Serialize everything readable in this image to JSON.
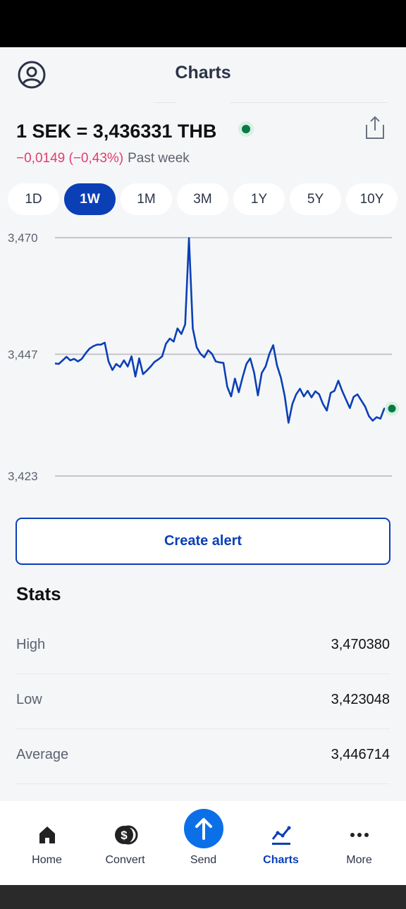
{
  "header": {
    "title": "Charts",
    "profile_icon": "profile-icon",
    "share_icon": "share-icon"
  },
  "rate": {
    "text": "1 SEK = 3,436331 THB",
    "change": "−0,0149 (−0,43%)",
    "period_text": "Past week",
    "live_color": "#067a46"
  },
  "tabs": [
    {
      "label": "1D",
      "active": false
    },
    {
      "label": "1W",
      "active": true
    },
    {
      "label": "1M",
      "active": false
    },
    {
      "label": "3M",
      "active": false
    },
    {
      "label": "1Y",
      "active": false
    },
    {
      "label": "5Y",
      "active": false
    },
    {
      "label": "10Y",
      "active": false
    }
  ],
  "chart_data": {
    "type": "line",
    "title": "",
    "xlabel": "",
    "ylabel": "",
    "ylim": [
      3.423,
      3.47
    ],
    "yticks": [
      3.47,
      3.447,
      3.423
    ],
    "ytick_labels": [
      "3,470",
      "3,447",
      "3,423"
    ],
    "grid": true,
    "series": [
      {
        "color": "#0a3fb6",
        "values": [
          3.4452,
          3.4451,
          3.4458,
          3.4465,
          3.4458,
          3.4461,
          3.4456,
          3.4461,
          3.4472,
          3.4481,
          3.4486,
          3.4489,
          3.4489,
          3.4493,
          3.4456,
          3.4439,
          3.4451,
          3.4445,
          3.4458,
          3.4446,
          3.4466,
          3.4426,
          3.4462,
          3.4431,
          3.4438,
          3.4446,
          3.4455,
          3.446,
          3.4466,
          3.4491,
          3.4501,
          3.4495,
          3.4521,
          3.451,
          3.4529,
          3.4699,
          3.4521,
          3.4484,
          3.4471,
          3.4464,
          3.4478,
          3.4471,
          3.4456,
          3.4454,
          3.4453,
          3.4406,
          3.4387,
          3.4422,
          3.4395,
          3.4425,
          3.4451,
          3.4462,
          3.4434,
          3.4389,
          3.4433,
          3.4446,
          3.4471,
          3.4488,
          3.4448,
          3.4424,
          3.4388,
          3.4335,
          3.4372,
          3.4391,
          3.4402,
          3.4387,
          3.4398,
          3.4385,
          3.4397,
          3.4391,
          3.4372,
          3.4359,
          3.4394,
          3.4398,
          3.4418,
          3.4398,
          3.4381,
          3.4364,
          3.4386,
          3.4391,
          3.4379,
          3.4367,
          3.4348,
          3.4339,
          3.4346,
          3.4343,
          3.4363,
          3.4363,
          3.4363
        ]
      }
    ]
  },
  "chart_annotation": {
    "latest_dot_color": "#067a46"
  },
  "create_alert_label": "Create alert",
  "stats": {
    "title": "Stats",
    "rows": [
      {
        "label": "High",
        "value": "3,470380"
      },
      {
        "label": "Low",
        "value": "3,423048"
      },
      {
        "label": "Average",
        "value": "3,446714"
      }
    ]
  },
  "nav": [
    {
      "label": "Home",
      "icon": "home-icon",
      "active": false
    },
    {
      "label": "Convert",
      "icon": "dollar-coins-icon",
      "active": false
    },
    {
      "label": "Send",
      "icon": "arrow-up-icon",
      "active": false
    },
    {
      "label": "Charts",
      "icon": "line-chart-icon",
      "active": true
    },
    {
      "label": "More",
      "icon": "more-dots-icon",
      "active": false
    }
  ],
  "colors": {
    "accent": "#0a3fb6",
    "send_button": "#0b6fe8",
    "negative": "#e33d6a",
    "live": "#067a46"
  }
}
